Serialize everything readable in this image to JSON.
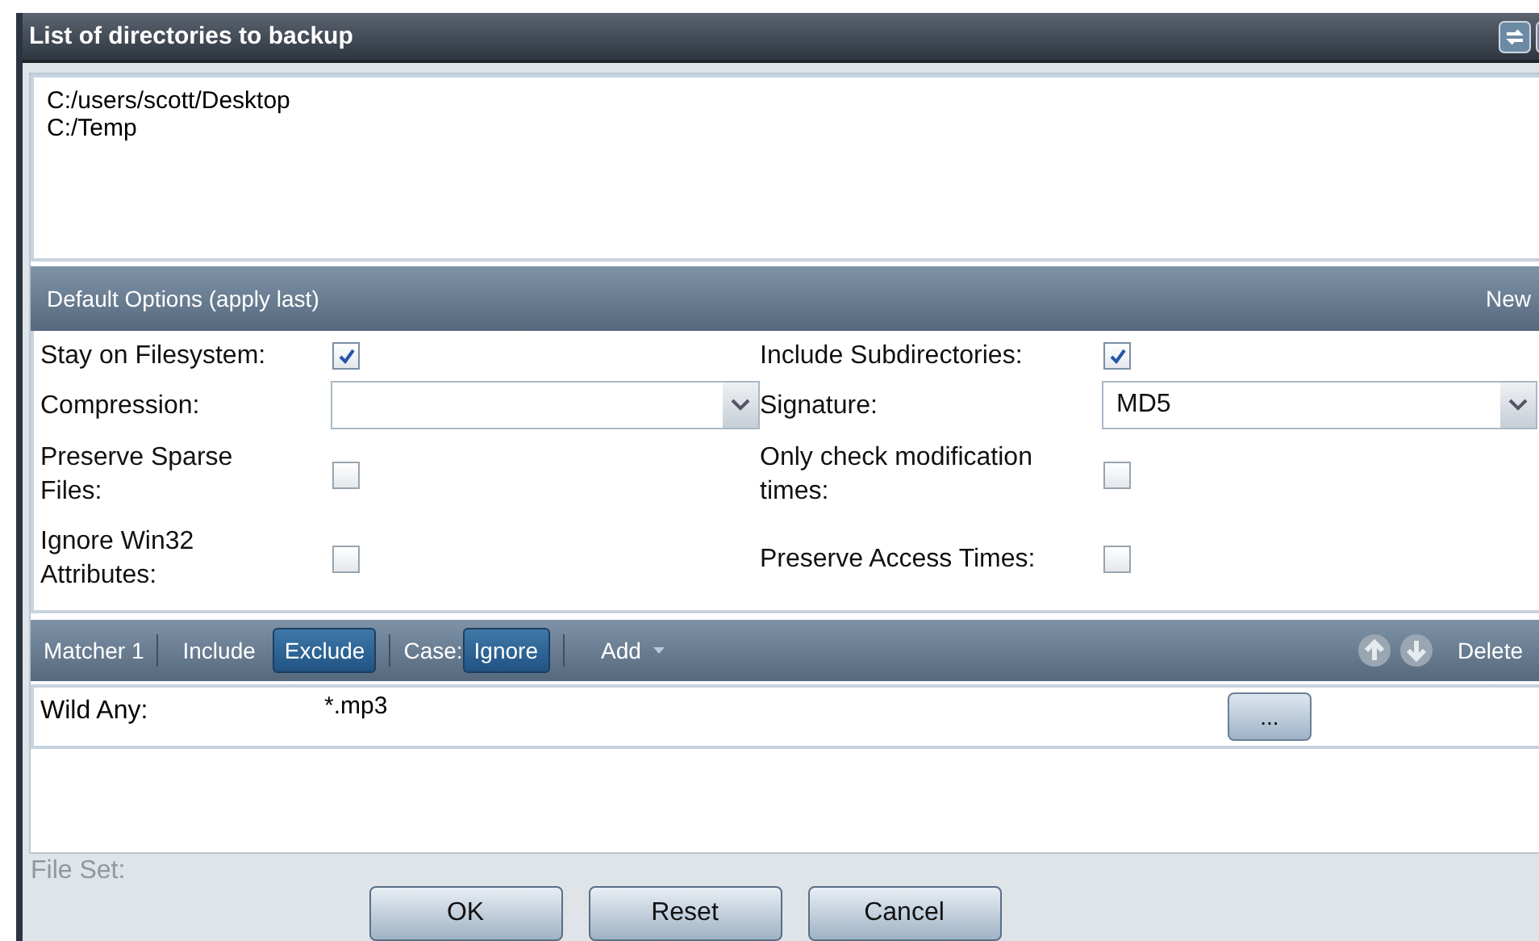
{
  "window": {
    "title": "List of directories to backup"
  },
  "directories": [
    "C:/users/scott/Desktop",
    "C:/Temp"
  ],
  "default_options": {
    "title": "Default Options (apply last)",
    "action": "New",
    "fields": [
      {
        "kind": "checkbox",
        "label": "Stay on Filesystem:",
        "checked": true
      },
      {
        "kind": "checkbox",
        "label": "Include Subdirectories:",
        "checked": true
      },
      {
        "kind": "select",
        "label": "Compression:"
      },
      {
        "kind": "select",
        "label": "Signature:",
        "value": "MD5"
      },
      {
        "kind": "checkbox",
        "label": "Preserve Sparse Files:",
        "checked": false
      },
      {
        "kind": "checkbox",
        "label": "Only check modification times:",
        "checked": false
      },
      {
        "kind": "checkbox",
        "label": "Ignore Win32 Attributes:",
        "checked": false
      },
      {
        "kind": "checkbox",
        "label": "Preserve Access Times:",
        "checked": false
      }
    ]
  },
  "matcher": {
    "label": "Matcher 1",
    "modes": [
      {
        "label": "Include",
        "selected": false
      },
      {
        "label": "Exclude",
        "selected": true
      }
    ],
    "case_label": "Case:",
    "case_button": {
      "label": "Ignore",
      "selected": true
    },
    "add": "Add",
    "delete": "Delete",
    "rule": {
      "label": "Wild Any:",
      "value": "*.mp3",
      "browse": "..."
    }
  },
  "background": {
    "label": "File Set:"
  },
  "buttons": [
    "OK",
    "Reset",
    "Cancel"
  ]
}
